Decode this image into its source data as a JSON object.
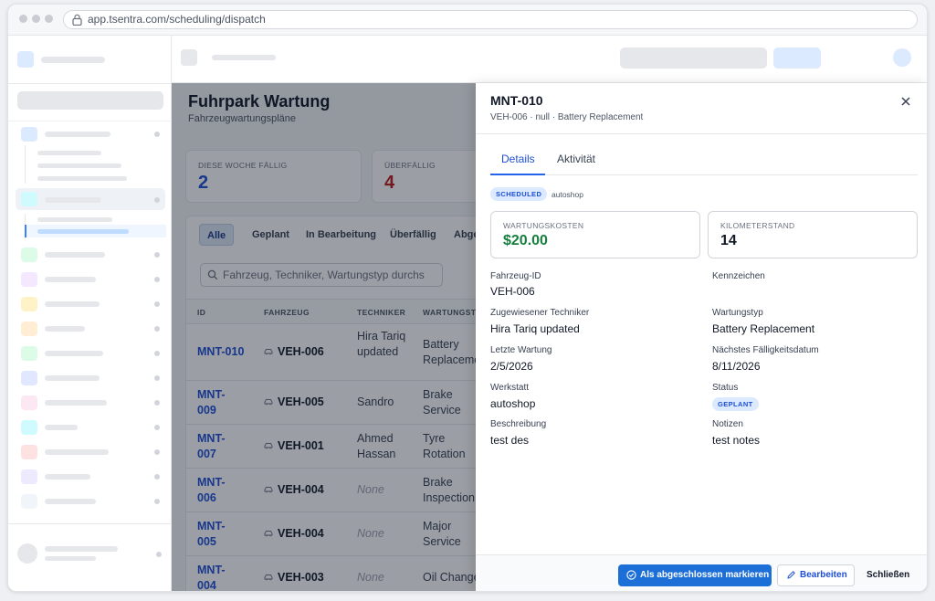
{
  "browser": {
    "url": "app.tsentra.com/scheduling/dispatch"
  },
  "page": {
    "title": "Fuhrpark Wartung",
    "subtitle": "Fahrzeugwartungspläne"
  },
  "stats": [
    {
      "label": "DIESE WOCHE FÄLLIG",
      "value": "2",
      "color": "#1d4ed8"
    },
    {
      "label": "ÜBERFÄLLIG",
      "value": "4",
      "color": "#b91c1c"
    }
  ],
  "filter_tabs": [
    "Alle",
    "Geplant",
    "In Bearbeitung",
    "Überfällig",
    "Abges"
  ],
  "search": {
    "placeholder": "Fahrzeug, Techniker, Wartungstyp durchs"
  },
  "table": {
    "columns": [
      "ID",
      "FAHRZEUG",
      "TECHNIKER",
      "WARTUNGST"
    ],
    "rows": [
      {
        "id": "MNT-010",
        "vehicle": "VEH-006",
        "tech": "Hira Tariq updated",
        "type": "Battery Replaceme"
      },
      {
        "id": "MNT-009",
        "vehicle": "VEH-005",
        "tech": "Sandro",
        "type": "Brake Service"
      },
      {
        "id": "MNT-007",
        "vehicle": "VEH-001",
        "tech": "Ahmed Hassan",
        "type": "Tyre Rotation"
      },
      {
        "id": "MNT-006",
        "vehicle": "VEH-004",
        "tech": "None",
        "type": "Brake Inspection"
      },
      {
        "id": "MNT-005",
        "vehicle": "VEH-004",
        "tech": "None",
        "type": "Major Service"
      },
      {
        "id": "MNT-004",
        "vehicle": "VEH-003",
        "tech": "None",
        "type": "Oil Change"
      }
    ]
  },
  "drawer": {
    "title": "MNT-010",
    "subtitle": "VEH-006 · null · Battery Replacement",
    "tabs": [
      "Details",
      "Aktivität"
    ],
    "status_badge": "SCHEDULED",
    "shop_tag": "autoshop",
    "metrics": [
      {
        "label": "WARTUNGSKOSTEN",
        "value": "$20.00",
        "color": "#15803d"
      },
      {
        "label": "KILOMETERSTAND",
        "value": "14",
        "color": "#111827"
      }
    ],
    "fields": {
      "vehicle_id": {
        "label": "Fahrzeug-ID",
        "value": "VEH-006"
      },
      "plate": {
        "label": "Kennzeichen",
        "value": ""
      },
      "technician": {
        "label": "Zugewiesener Techniker",
        "value": "Hira Tariq updated"
      },
      "type": {
        "label": "Wartungstyp",
        "value": "Battery Replacement"
      },
      "last": {
        "label": "Letzte Wartung",
        "value": "2/5/2026"
      },
      "next": {
        "label": "Nächstes Fälligkeitsdatum",
        "value": "8/11/2026"
      },
      "shop": {
        "label": "Werkstatt",
        "value": "autoshop"
      },
      "status": {
        "label": "Status",
        "value": "GEPLANT"
      },
      "description": {
        "label": "Beschreibung",
        "value": "test des"
      },
      "notes": {
        "label": "Notizen",
        "value": "test notes"
      }
    },
    "buttons": {
      "complete": "Als abgeschlossen markieren",
      "edit": "Bearbeiten",
      "close": "Schließen"
    }
  },
  "colors": {
    "accent": "#1d6fd8",
    "overdue": "#b91c1c",
    "cost": "#15803d"
  }
}
